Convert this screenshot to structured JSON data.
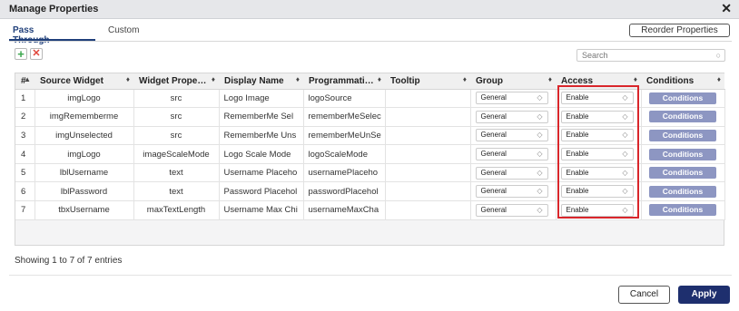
{
  "dialog": {
    "title": "Manage Properties",
    "close_glyph": "✕"
  },
  "tabs": [
    {
      "label": "Pass Through",
      "active": true
    },
    {
      "label": "Custom",
      "active": false
    }
  ],
  "toolbar": {
    "reorder_label": "Reorder Properties",
    "add_glyph": "+",
    "delete_glyph": "✕"
  },
  "search": {
    "placeholder": "Search",
    "icon": "search-icon"
  },
  "table": {
    "headers": [
      "#",
      "Source Widget",
      "Widget Prope…",
      "Display Name",
      "Programmati…",
      "Tooltip",
      "Group",
      "Access",
      "Conditions"
    ],
    "rows": [
      {
        "num": "1",
        "source": "imgLogo",
        "prop": "src",
        "display": "Logo Image",
        "prog": "logoSource",
        "tooltip": "",
        "group": "General",
        "access": "Enable",
        "cond": "Conditions"
      },
      {
        "num": "2",
        "source": "imgRememberme",
        "prop": "src",
        "display": "RememberMe Sel",
        "prog": "rememberMeSelec",
        "tooltip": "",
        "group": "General",
        "access": "Enable",
        "cond": "Conditions"
      },
      {
        "num": "3",
        "source": "imgUnselected",
        "prop": "src",
        "display": "RememberMe Uns",
        "prog": "rememberMeUnSe",
        "tooltip": "",
        "group": "General",
        "access": "Enable",
        "cond": "Conditions"
      },
      {
        "num": "4",
        "source": "imgLogo",
        "prop": "imageScaleMode",
        "display": "Logo Scale Mode",
        "prog": "logoScaleMode",
        "tooltip": "",
        "group": "General",
        "access": "Enable",
        "cond": "Conditions"
      },
      {
        "num": "5",
        "source": "lblUsername",
        "prop": "text",
        "display": "Username Placeho",
        "prog": "usernamePlaceho",
        "tooltip": "",
        "group": "General",
        "access": "Enable",
        "cond": "Conditions"
      },
      {
        "num": "6",
        "source": "lblPassword",
        "prop": "text",
        "display": "Password Placehol",
        "prog": "passwordPlacehol",
        "tooltip": "",
        "group": "General",
        "access": "Enable",
        "cond": "Conditions"
      },
      {
        "num": "7",
        "source": "tbxUsername",
        "prop": "maxTextLength",
        "display": "Username Max Chi",
        "prog": "usernameMaxCha",
        "tooltip": "",
        "group": "General",
        "access": "Enable",
        "cond": "Conditions"
      }
    ]
  },
  "footer": {
    "entries_text": "Showing 1 to 7 of 7 entries",
    "cancel_label": "Cancel",
    "apply_label": "Apply"
  },
  "colors": {
    "accent": "#1e2f6e",
    "conditions_button": "#8d96c2",
    "highlight": "#d9262b",
    "add": "#3aa64c",
    "delete": "#e0453a"
  }
}
